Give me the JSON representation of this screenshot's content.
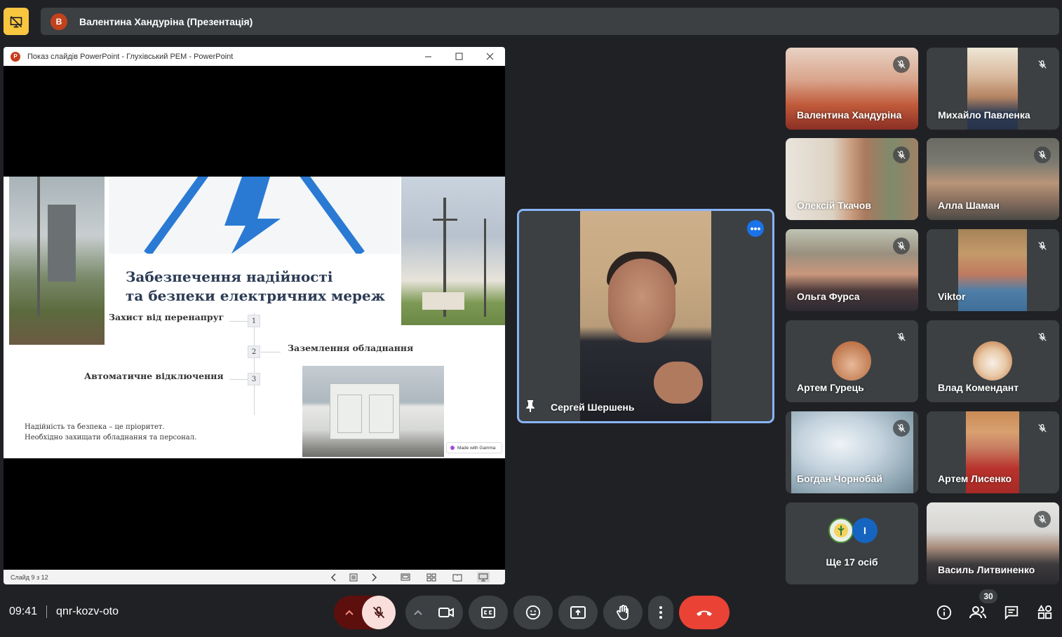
{
  "presenter_bar": {
    "avatar_letter": "В",
    "title": "Валентина Хандуріна (Презентація)"
  },
  "ppt_window": {
    "title": "Показ слайдів PowerPoint  -  Глухівський РЕМ - PowerPoint",
    "status": "Слайд 9 з 12"
  },
  "slide": {
    "title_line1": "Забезпечення надійності",
    "title_line2": "та безпеки електричних мереж",
    "items": [
      {
        "num": "1",
        "text": "Захист від перенапруг"
      },
      {
        "num": "2",
        "text": "Заземлення обладнання"
      },
      {
        "num": "3",
        "text": "Автоматичне відключення"
      }
    ],
    "footer_line1": "Надійність та безпека – це пріоритет.",
    "footer_line2": "Необхідно захищати обладнання та персонал.",
    "badge": "Made with Gamma"
  },
  "pinned": {
    "name": "Сергей Шершень",
    "more": "•••"
  },
  "participants": [
    {
      "name": "Валентина Хандуріна"
    },
    {
      "name": "Михайло Павленка"
    },
    {
      "name": "Олексій Ткачов"
    },
    {
      "name": "Алла Шаман"
    },
    {
      "name": "Ольга Фурса"
    },
    {
      "name": "Viktor"
    },
    {
      "name": "Артем Гурець"
    },
    {
      "name": "Влад Комендант"
    },
    {
      "name": "Богдан Чорнобай"
    },
    {
      "name": "Артем Лисенко"
    },
    {
      "name": "Василь Литвиненко"
    }
  ],
  "more_tile": {
    "label": "Ще 17 осіб",
    "avatar_letter": "I"
  },
  "bottom": {
    "time": "09:41",
    "meeting_code": "qnr-kozv-oto",
    "people_count": "30"
  },
  "colors": {
    "accent": "#8ab4f8",
    "end_call": "#ea4335",
    "mic_off_bg": "#f9dedc",
    "presenter_icon": "#f9c640"
  }
}
